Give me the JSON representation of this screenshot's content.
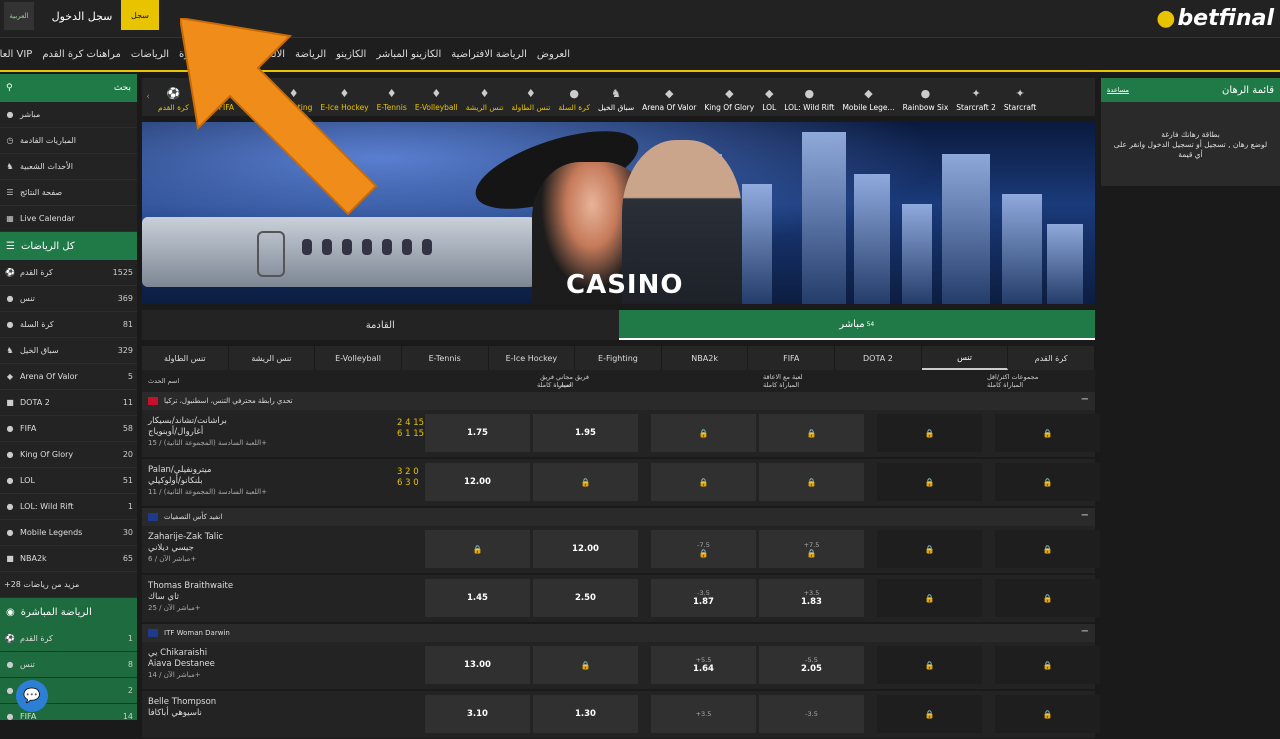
{
  "top": {
    "lang": "العربية",
    "login": "سجل الدخول",
    "register": "سجل",
    "logo": "betfinal"
  },
  "nav": [
    "العروض",
    "الرياضة الافتراضية",
    "الكازينو المباشر",
    "الكازينو",
    "الرياضة",
    "الألعاب الرياضية المباشرة",
    "الرياضات",
    "مراهنات كرة القدم",
    "العاب المباشرة VIP"
  ],
  "sidebar": {
    "search": "بحث",
    "quick": [
      {
        "icon": "●",
        "label": "مباشر"
      },
      {
        "icon": "◷",
        "label": "المباريات القادمة"
      },
      {
        "icon": "♞",
        "label": "الأحداث الشعبية"
      },
      {
        "icon": "☰",
        "label": "صفحة النتائج"
      },
      {
        "icon": "▦",
        "label": "Live Calendar"
      }
    ],
    "all_sports_title": "كل الرياضات",
    "sports": [
      {
        "icon": "⚽",
        "label": "كرة القدم",
        "count": "1525"
      },
      {
        "icon": "●",
        "label": "تنس",
        "count": "369"
      },
      {
        "icon": "●",
        "label": "كرة السلة",
        "count": "81"
      },
      {
        "icon": "♞",
        "label": "سباق الخيل",
        "count": "329"
      },
      {
        "icon": "◆",
        "label": "Arena Of Valor",
        "count": "5"
      },
      {
        "icon": "■",
        "label": "DOTA 2",
        "count": "11"
      },
      {
        "icon": "●",
        "label": "FIFA",
        "count": "58"
      },
      {
        "icon": "●",
        "label": "King Of Glory",
        "count": "20"
      },
      {
        "icon": "●",
        "label": "LOL",
        "count": "51"
      },
      {
        "icon": "●",
        "label": "LOL: Wild Rift",
        "count": "1"
      },
      {
        "icon": "●",
        "label": "Mobile Legends",
        "count": "30"
      },
      {
        "icon": "■",
        "label": "NBA2k",
        "count": "65"
      }
    ],
    "more": "+مزيد من رياضات 28",
    "live_title": "الرياضة المباشرة",
    "live": [
      {
        "icon": "⚽",
        "label": "كرة القدم",
        "count": "1"
      },
      {
        "icon": "●",
        "label": "تنس",
        "count": "8"
      },
      {
        "icon": "●",
        "label": "",
        "count": "2"
      },
      {
        "icon": "●",
        "label": "FIFA",
        "count": "14"
      }
    ]
  },
  "sportbar": [
    {
      "icon": "⚽",
      "label": "كرة القدم",
      "badge": "1",
      "white": false
    },
    {
      "icon": "●",
      "label": "تنس",
      "badge": "",
      "white": false
    },
    {
      "icon": "●",
      "label": "FIFA",
      "badge": "",
      "white": false
    },
    {
      "icon": "■",
      "label": "NBA2k",
      "badge": "9",
      "white": false
    },
    {
      "icon": "♦",
      "label": "E-Fighting",
      "badge": "2",
      "white": false
    },
    {
      "icon": "♦",
      "label": "E-Ice Hockey",
      "badge": "2",
      "white": false
    },
    {
      "icon": "♦",
      "label": "E-Tennis",
      "badge": "4",
      "white": false
    },
    {
      "icon": "♦",
      "label": "E-Volleyball",
      "badge": "2",
      "white": false
    },
    {
      "icon": "♦",
      "label": "تنس الريشة",
      "badge": "3",
      "white": false
    },
    {
      "icon": "♦",
      "label": "تنس الطاولة",
      "badge": "9",
      "white": false
    },
    {
      "icon": "●",
      "label": "كرة السلة",
      "badge": "",
      "white": false
    },
    {
      "icon": "♞",
      "label": "سباق الخيل",
      "badge": "",
      "white": true
    },
    {
      "icon": "◆",
      "label": "Arena Of Valor",
      "badge": "",
      "white": true
    },
    {
      "icon": "◆",
      "label": "King Of Glory",
      "badge": "",
      "white": true
    },
    {
      "icon": "◆",
      "label": "LOL",
      "badge": "",
      "white": true
    },
    {
      "icon": "●",
      "label": "LOL: Wild Rift",
      "badge": "",
      "white": true
    },
    {
      "icon": "◆",
      "label": "Mobile Lege...",
      "badge": "",
      "white": true
    },
    {
      "icon": "●",
      "label": "Rainbow Six",
      "badge": "",
      "white": true
    },
    {
      "icon": "✦",
      "label": "Starcraft 2",
      "badge": "",
      "white": true
    },
    {
      "icon": "✦",
      "label": "Starcraft",
      "badge": "",
      "white": true
    }
  ],
  "banner": {
    "text": "CASINO"
  },
  "tabs": {
    "live": "مباشر",
    "live_count": "54",
    "upcoming": "القادمة"
  },
  "subtabs": [
    "كرة القدم",
    "تنس",
    "DOTA 2",
    "FIFA",
    "NBA2k",
    "E-Fighting",
    "E-Ice Hockey",
    "E-Tennis",
    "E-Volleyball",
    "تنس الريشة",
    "تنس الطاولة"
  ],
  "header": {
    "event": "اسم الحدث",
    "col1": "فريق مجاني فريق ضيف",
    "col1b": "المباراة كاملة",
    "col2": "لعبة مع الاعاقة",
    "col2b": "المباراة كاملة",
    "col3": "مجموعات اكثر/اقل",
    "col3b": "المباراة كاملة"
  },
  "leagues": [
    {
      "name": "تحدي رابطة محترفي التنس، اسطنبول، تركيا",
      "flag": "#c8102e"
    },
    {
      "name": "انفيد كأس التصفيات",
      "flag": "#1e3a8a"
    },
    {
      "name": "ITF Woman Darwin",
      "flag": "#1e3a8a"
    }
  ],
  "matches": [
    {
      "t1": "براشانت/تشاند/بسيكار",
      "t2": "أغاروال/أوبنوياج",
      "meta": "اللعبة السادسة (المجموعة الثانية) / 15+",
      "score1": "2 4 15",
      "score2": "6 1 15",
      "o1": "1.75",
      "o2": "1.95",
      "h1a": "",
      "h1": "🔒",
      "h2a": "",
      "h2": "🔒",
      "t3a": "🔒",
      "t3b": "🔒"
    },
    {
      "t1": "Palan/ميترونفيلي",
      "t2": "بلنكانو/أولوكيلي",
      "meta": "اللعبة السادسة (المجموعة الثانية) / 11+",
      "score1": "3 2 0",
      "score2": "6 3 0",
      "o1": "12.00",
      "o2": "🔒",
      "h1a": "",
      "h1": "🔒",
      "h2a": "",
      "h2": "🔒",
      "t3a": "🔒",
      "t3b": "🔒"
    },
    {
      "t1": "Zaharije-Zak Talic",
      "t2": "جيسي ديلاني",
      "meta": "مباشر الآن / 6+",
      "score1": "",
      "score2": "",
      "o1": "🔒",
      "o2": "12.00",
      "h1a": "-7.5",
      "h1": "🔒",
      "h2a": "+7.5",
      "h2": "🔒",
      "t3a": "🔒",
      "t3b": "🔒"
    },
    {
      "t1": "Thomas Braithwaite",
      "t2": "ثاي ساك",
      "meta": "مباشر الآن / 25+",
      "score1": "",
      "score2": "",
      "o1": "1.45",
      "o2": "2.50",
      "h1a": "-3.5",
      "h1": "1.87",
      "h2a": "+3.5",
      "h2": "1.83",
      "t3a": "🔒",
      "t3b": "🔒"
    },
    {
      "t1": "يي Chikaraishi",
      "t2": "Aiava Destanee",
      "meta": "مباشر الآن / 14+",
      "score1": "",
      "score2": "",
      "o1": "13.00",
      "o2": "🔒",
      "h1a": "+5.5",
      "h1": "1.64",
      "h2a": "-5.5",
      "h2": "2.05",
      "t3a": "🔒",
      "t3b": "🔒"
    },
    {
      "t1": "Belle Thompson",
      "t2": "ناسيوهي أباكافا",
      "meta": "",
      "score1": "",
      "score2": "",
      "o1": "3.10",
      "o2": "1.30",
      "h1a": "+3.5",
      "h1": "",
      "h2a": "-3.5",
      "h2": "",
      "t3a": "🔒",
      "t3b": "🔒"
    }
  ],
  "right": {
    "title": "قائمة الرهان",
    "help": "مساعدة",
    "empty1": "بطاقة رهانك فارغة",
    "empty2": "لوضع رهان , تسجيل أو تسجيل الدخول وانقر على أي قيمة"
  },
  "colors": {
    "green": "#1f7a48",
    "yellow": "#e8c400",
    "arrow": "#f08c1a"
  }
}
